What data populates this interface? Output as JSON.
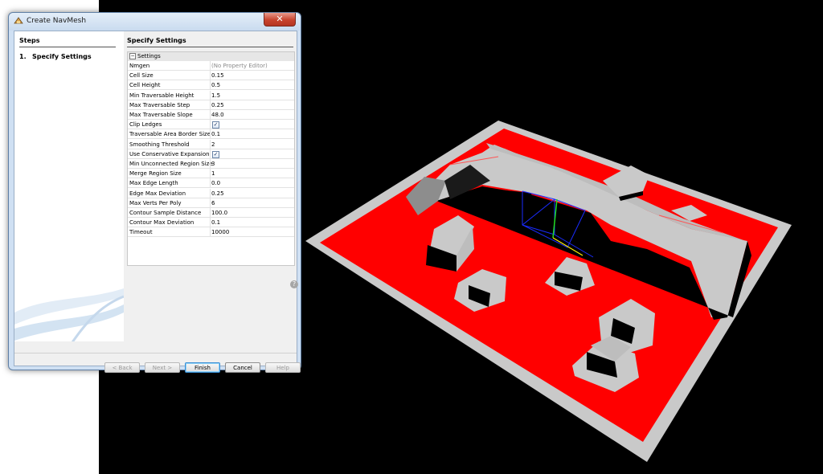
{
  "window": {
    "title": "Create NavMesh",
    "close_label": "✕"
  },
  "steps": {
    "title": "Steps",
    "items": [
      {
        "number": "1.",
        "label": "Specify Settings"
      }
    ]
  },
  "settings": {
    "title": "Specify Settings",
    "group_toggle": "−",
    "group_label": "Settings",
    "rows": [
      {
        "name": "Nmgen",
        "value": "(No Property Editor)",
        "dim": true
      },
      {
        "name": "Cell Size",
        "value": "0.15"
      },
      {
        "name": "Cell Height",
        "value": "0.5"
      },
      {
        "name": "Min Traversable Height",
        "value": "1.5"
      },
      {
        "name": "Max Traversable Step",
        "value": "0.25"
      },
      {
        "name": "Max Traversable Slope",
        "value": "48.0"
      },
      {
        "name": "Clip Ledges",
        "checkbox": true,
        "checked": "✓"
      },
      {
        "name": "Traversable Area Border Size",
        "value": "0.1"
      },
      {
        "name": "Smoothing Threshold",
        "value": "2"
      },
      {
        "name": "Use Conservative Expansion",
        "checkbox": true,
        "checked": "✓"
      },
      {
        "name": "Min Unconnected Region Size",
        "value": "3"
      },
      {
        "name": "Merge Region Size",
        "value": "1"
      },
      {
        "name": "Max Edge Length",
        "value": "0.0"
      },
      {
        "name": "Edge Max Deviation",
        "value": "0.25"
      },
      {
        "name": "Max Verts Per Poly",
        "value": "6"
      },
      {
        "name": "Contour Sample Distance",
        "value": "100.0"
      },
      {
        "name": "Contour Max Deviation",
        "value": "0.1"
      },
      {
        "name": "Timeout",
        "value": "10000"
      }
    ],
    "help_label": "?"
  },
  "buttons": {
    "back": "< Back",
    "next": "Next >",
    "finish": "Finish",
    "cancel": "Cancel",
    "help": "Help"
  },
  "colors": {
    "navmesh": "#ff0000",
    "ground": "#c9c9c9",
    "obstacle": "#000000"
  }
}
